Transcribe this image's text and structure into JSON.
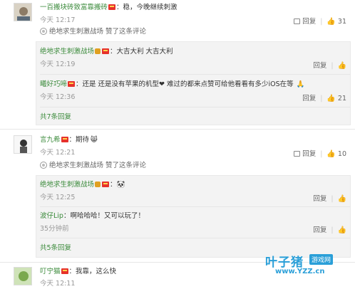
{
  "comments": [
    {
      "username": "一百搬块砖致富靠搬砖",
      "text": "：稳，今晚继续刺激",
      "time": "今天 12:17",
      "reply_label": "回复",
      "likes": "31",
      "liked_by_name": "绝地求生刺激战场",
      "liked_by_suffix": "赞了这条评论",
      "replies": [
        {
          "username": "绝地求生刺激战场",
          "text": "：大吉大利 大吉大利",
          "time": "今天 12:19",
          "reply_label": "回复",
          "likes": ""
        },
        {
          "username": "曦好巧啼",
          "text": "：还是 还是没有苹果的机型❤ 难过的都来点赞可给他看看有多少iOS在等",
          "time": "今天 12:36",
          "reply_label": "回复",
          "likes": "21"
        }
      ],
      "more_replies": "共7条回复"
    },
    {
      "username": "言九希",
      "text": "：期待",
      "time": "今天 12:21",
      "reply_label": "回复",
      "likes": "10",
      "liked_by_name": "绝地求生刺激战场",
      "liked_by_suffix": "赞了这条评论",
      "replies": [
        {
          "username": "绝地求生刺激战场",
          "text": "：",
          "time": "今天 12:25",
          "reply_label": "回复",
          "likes": ""
        },
        {
          "username": "波仔Lip",
          "text": "：啊哈哈哈！又可以玩了！",
          "time": "35分钟前",
          "reply_label": "回复",
          "likes": ""
        }
      ],
      "more_replies": "共5条回复"
    },
    {
      "username": "叮宁猫",
      "text": "：我靠，这么快",
      "time": "今天 12:11",
      "reply_label": "",
      "likes": ""
    }
  ],
  "watermark": {
    "brand": "叶子猪",
    "tag": "游戏网",
    "url": "www.YZZ.cn"
  },
  "colors": {
    "name": "#3a8a3a",
    "vip": "#e6312b",
    "watermark": "#2a9fd8"
  }
}
